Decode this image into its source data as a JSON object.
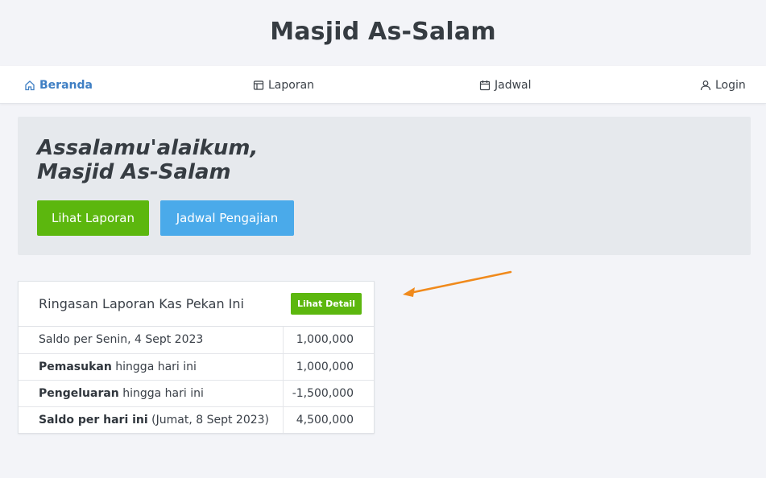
{
  "site": {
    "title": "Masjid As-Salam"
  },
  "nav": {
    "items": [
      {
        "label": "Beranda",
        "icon": "home-icon",
        "active": true
      },
      {
        "label": "Laporan",
        "icon": "report-icon",
        "active": false
      },
      {
        "label": "Jadwal",
        "icon": "calendar-icon",
        "active": false
      },
      {
        "label": "Login",
        "icon": "user-icon",
        "active": false
      }
    ]
  },
  "hero": {
    "greeting_line1": "Assalamu'alaikum,",
    "greeting_line2": "Masjid As-Salam",
    "primary_button": "Lihat Laporan",
    "secondary_button": "Jadwal Pengajian"
  },
  "summary": {
    "title": "Ringasan Laporan Kas Pekan Ini",
    "detail_button": "Lihat Detail",
    "rows": [
      {
        "bold": "",
        "text": "Saldo per Senin, 4 Sept 2023",
        "value": "1,000,000"
      },
      {
        "bold": "Pemasukan",
        "text": " hingga hari ini",
        "value": "1,000,000"
      },
      {
        "bold": "Pengeluaran",
        "text": " hingga hari ini",
        "value": "-1,500,000"
      },
      {
        "bold": "Saldo per hari ini",
        "text": " (Jumat, 8 Sept 2023)",
        "value": "4,500,000"
      }
    ]
  },
  "colors": {
    "accent_green": "#5cb70e",
    "accent_blue": "#4aaaea",
    "nav_active": "#3f7fc4",
    "arrow": "#f08a1c"
  }
}
